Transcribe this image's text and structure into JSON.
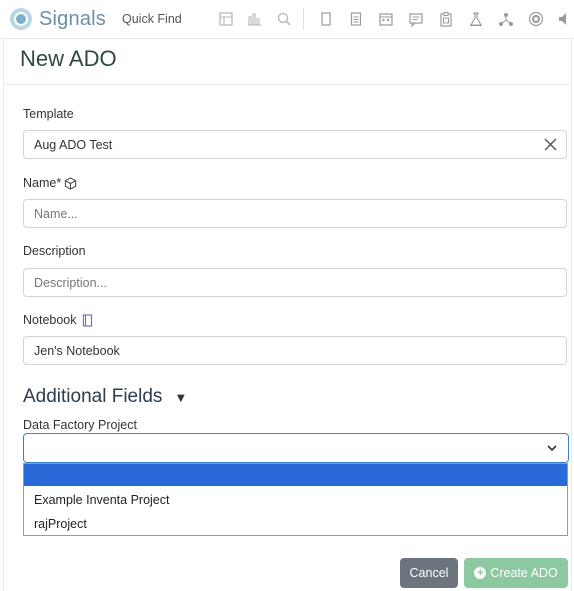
{
  "header": {
    "brand": "Signals",
    "quick_find": "Quick Find",
    "icons": [
      "dashboard-icon",
      "chart-icon",
      "search-icon",
      "notebook-icon",
      "document-icon",
      "calendar-icon",
      "message-icon",
      "clipboard-icon",
      "lab-icon",
      "network-icon",
      "target-icon",
      "audio-icon"
    ]
  },
  "page": {
    "title": "New ADO"
  },
  "form": {
    "template_label": "Template",
    "template_value": "Aug ADO Test",
    "name_label": "Name*",
    "name_placeholder": "Name...",
    "description_label": "Description",
    "description_placeholder": "Description...",
    "notebook_label": "Notebook",
    "notebook_value": "Jen's Notebook"
  },
  "additional": {
    "title": "Additional Fields",
    "data_factory_label": "Data Factory Project",
    "selected_value": "",
    "options": [
      "",
      "Example Inventa Project",
      "rajProject"
    ]
  },
  "buttons": {
    "cancel": "Cancel",
    "create": "Create ADO"
  },
  "colors": {
    "primary_blue": "#2a6ad8",
    "create_green": "#8cc9a0",
    "cancel_gray": "#6c757d",
    "title_green": "#2f4a3c"
  }
}
